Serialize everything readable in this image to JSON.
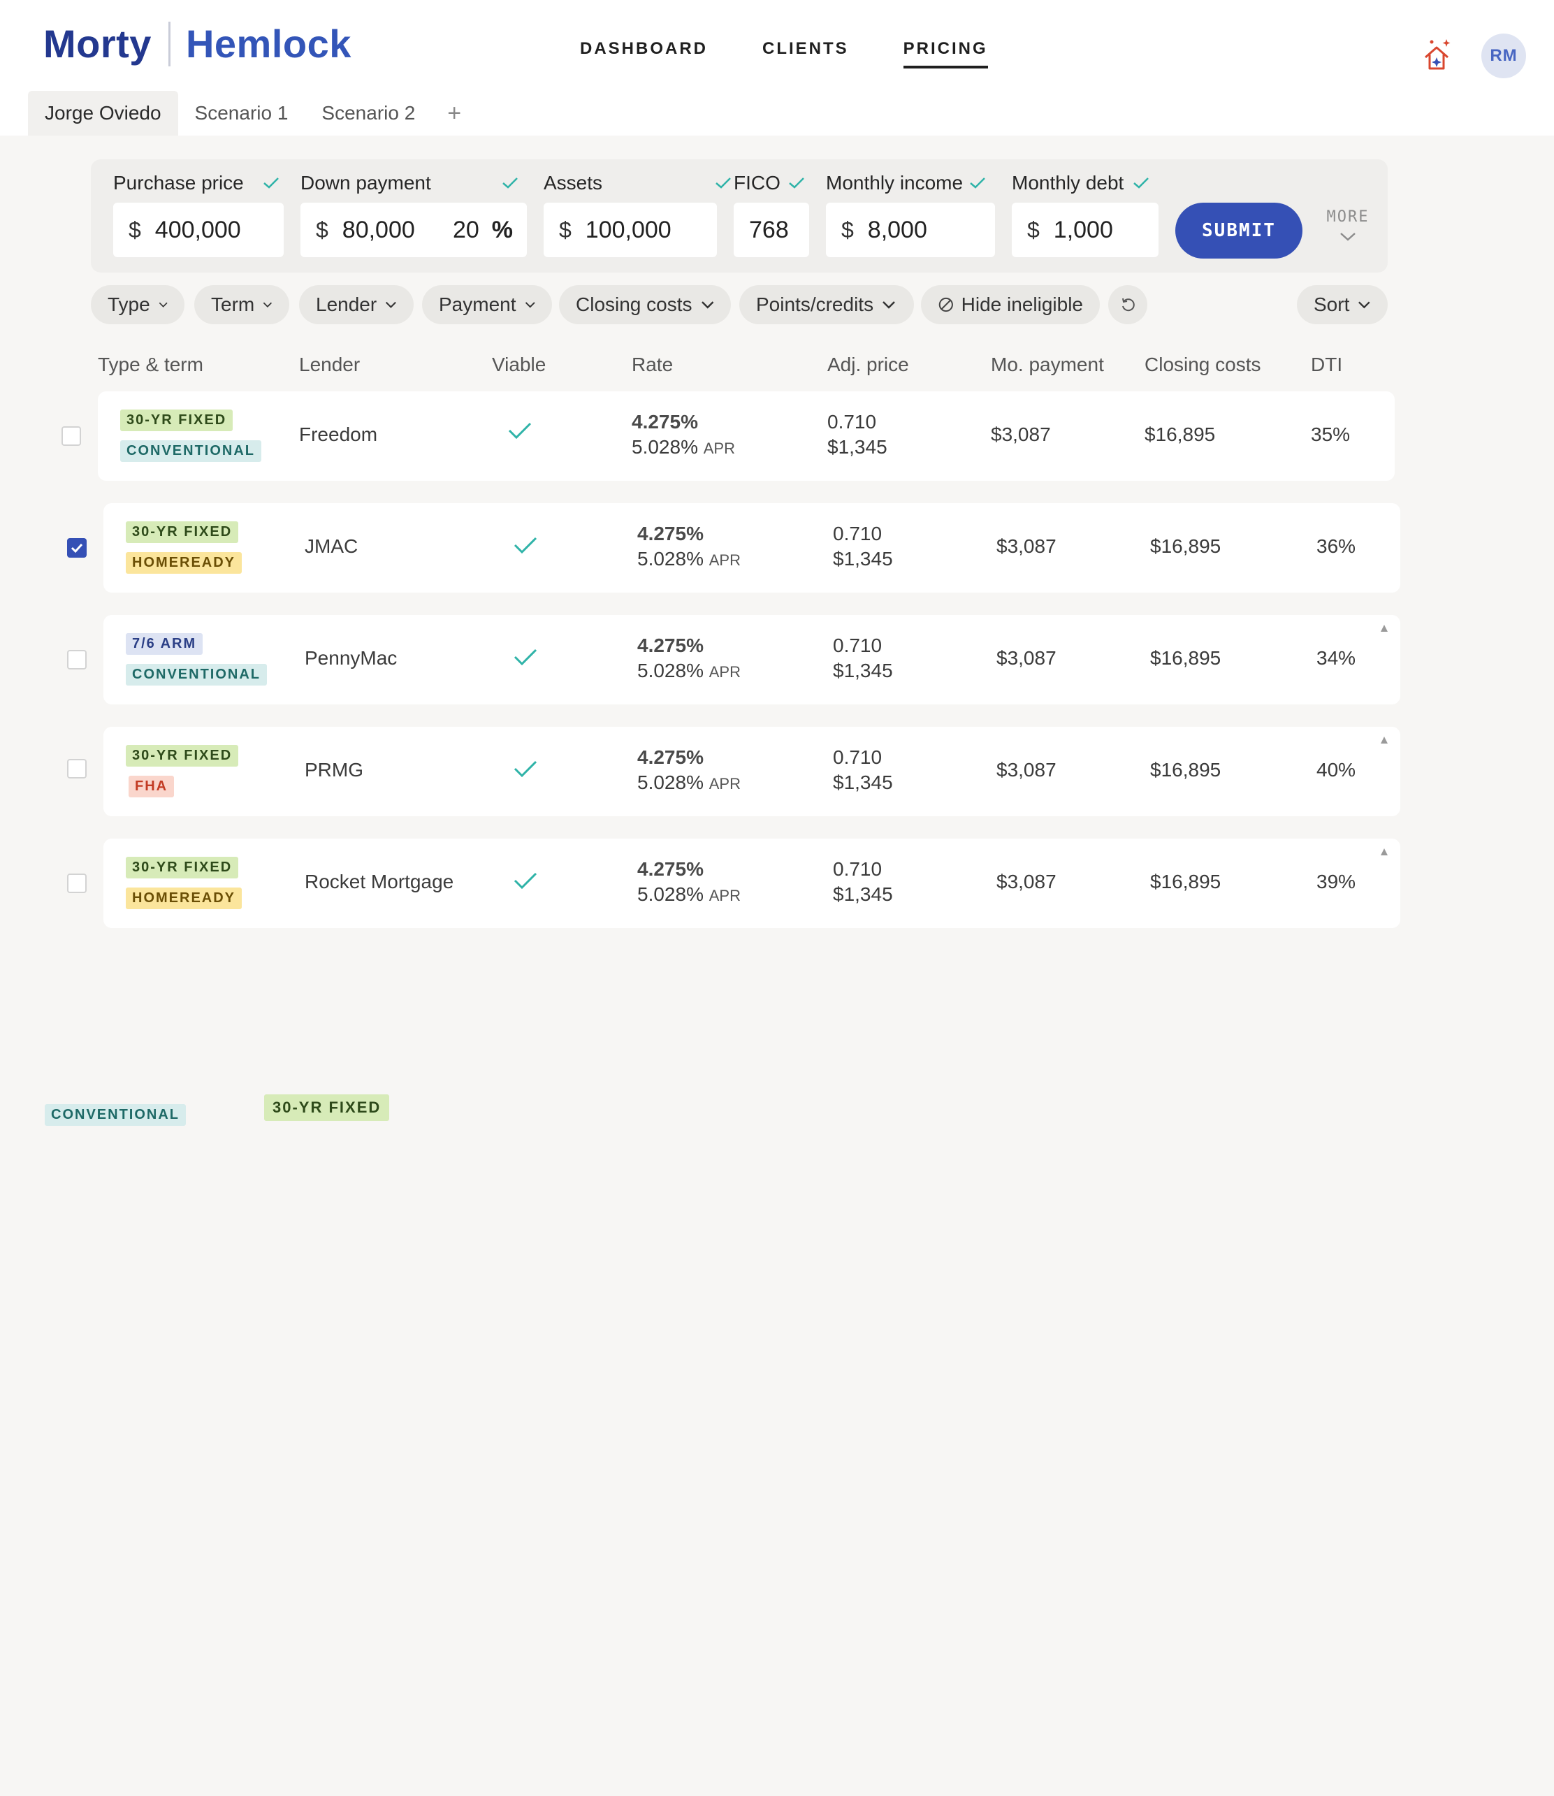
{
  "brand": {
    "left": "Morty",
    "right": "Hemlock"
  },
  "nav": {
    "dashboard": "DASHBOARD",
    "clients": "CLIENTS",
    "pricing": "PRICING",
    "active": "PRICING"
  },
  "user": {
    "initials": "RM"
  },
  "tabs": {
    "client": "Jorge Oviedo",
    "scenario1": "Scenario 1",
    "scenario2": "Scenario 2",
    "add": "+"
  },
  "inputs": {
    "purchase_price": {
      "label": "Purchase price",
      "currency": "$",
      "value": "400,000"
    },
    "down_payment": {
      "label": "Down payment",
      "currency": "$",
      "value": "80,000",
      "percent": "20",
      "percent_sign": "%"
    },
    "assets": {
      "label": "Assets",
      "currency": "$",
      "value": "100,000"
    },
    "fico": {
      "label": "FICO",
      "value": "768"
    },
    "monthly_income": {
      "label": "Monthly income",
      "currency": "$",
      "value": "8,000"
    },
    "monthly_debt": {
      "label": "Monthly debt",
      "currency": "$",
      "value": "1,000"
    },
    "submit": "SUBMIT",
    "more": "MORE"
  },
  "filters": {
    "type": "Type",
    "term": "Term",
    "lender": "Lender",
    "payment": "Payment",
    "closing_costs": "Closing costs",
    "points_credits": "Points/credits",
    "hide_ineligible": "Hide ineligible",
    "sort": "Sort"
  },
  "columns": {
    "type_term": "Type & term",
    "lender": "Lender",
    "viable": "Viable",
    "rate": "Rate",
    "adj_price": "Adj. price",
    "mo_payment": "Mo. payment",
    "closing_costs": "Closing costs",
    "dti": "DTI"
  },
  "rows": [
    {
      "checked": false,
      "term": "30-YR FIXED",
      "type": "CONVENTIONAL",
      "lender": "Freedom",
      "rate": "4.275%",
      "apr": "5.028%",
      "apr_label": "APR",
      "adj_price": "0.710",
      "adj_amount": "$1,345",
      "mo_payment": "$3,087",
      "closing_costs": "$16,895",
      "dti": "35%"
    },
    {
      "checked": true,
      "term": "30-YR FIXED",
      "type": "HOMEREADY",
      "lender": "JMAC",
      "rate": "4.275%",
      "apr": "5.028%",
      "apr_label": "APR",
      "adj_price": "0.710",
      "adj_amount": "$1,345",
      "mo_payment": "$3,087",
      "closing_costs": "$16,895",
      "dti": "36%"
    },
    {
      "checked": false,
      "term": "7/6 ARM",
      "type": "CONVENTIONAL",
      "lender": "PennyMac",
      "rate": "4.275%",
      "apr": "5.028%",
      "apr_label": "APR",
      "adj_price": "0.710",
      "adj_amount": "$1,345",
      "mo_payment": "$3,087",
      "closing_costs": "$16,895",
      "dti": "34%"
    },
    {
      "checked": false,
      "term": "30-YR FIXED",
      "type": "FHA",
      "lender": "PRMG",
      "rate": "4.275%",
      "apr": "5.028%",
      "apr_label": "APR",
      "adj_price": "0.710",
      "adj_amount": "$1,345",
      "mo_payment": "$3,087",
      "closing_costs": "$16,895",
      "dti": "40%"
    },
    {
      "checked": false,
      "term": "30-YR FIXED",
      "type": "HOMEREADY",
      "lender": "Rocket Mortgage",
      "rate": "4.275%",
      "apr": "5.028%",
      "apr_label": "APR",
      "adj_price": "0.710",
      "adj_amount": "$1,345",
      "mo_payment": "$3,087",
      "closing_costs": "$16,895",
      "dti": "39%"
    }
  ],
  "loose_badges": {
    "conventional": "CONVENTIONAL",
    "fixed": "30-YR FIXED"
  },
  "colors": {
    "brand_dark": "#23388f",
    "brand": "#3550b5",
    "check": "#2fb3a8"
  }
}
